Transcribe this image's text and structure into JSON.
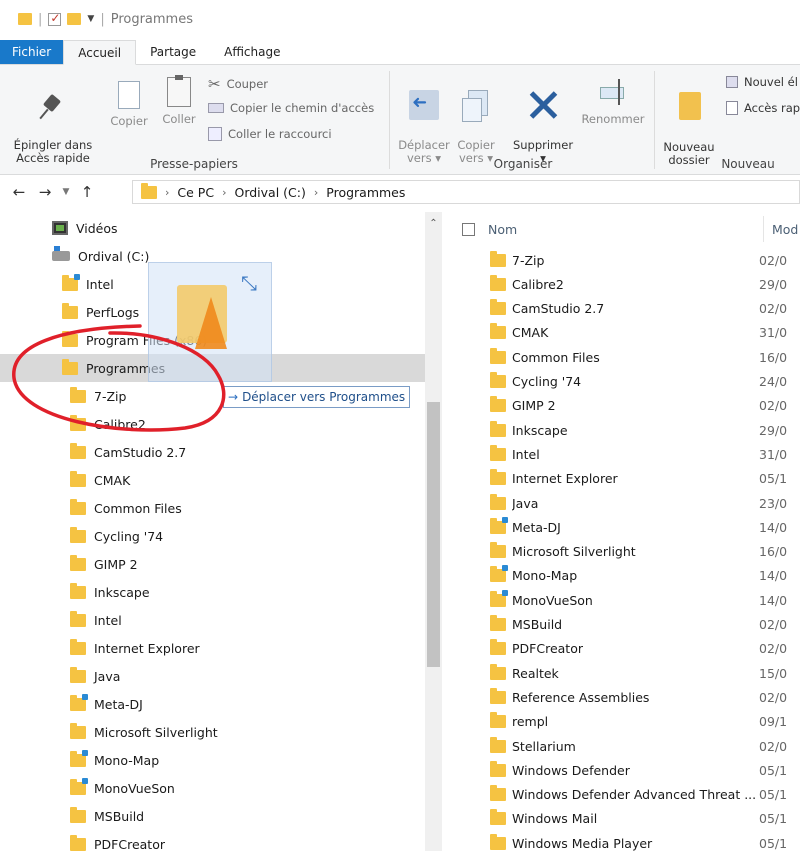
{
  "titlebar": {
    "title": "Programmes"
  },
  "ribbon_tabs": [
    "Fichier",
    "Accueil",
    "Partage",
    "Affichage"
  ],
  "ribbon": {
    "epingler": "Épingler dans\nAccès rapide",
    "copier": "Copier",
    "coller": "Coller",
    "couper": "Couper",
    "copier_chemin": "Copier le chemin d'accès",
    "coller_raccourci": "Coller le raccourci",
    "group_presse": "Presse-papiers",
    "deplacer_vers": "Déplacer\nvers ▾",
    "copier_vers": "Copier\nvers ▾",
    "supprimer": "Supprimer\n▾",
    "renommer": "Renommer",
    "group_organiser": "Organiser",
    "nouveau_dossier": "Nouveau\ndossier",
    "nouvel_element": "Nouvel él",
    "acces_rapide": "Accès rap",
    "group_nouveau": "Nouveau"
  },
  "address": {
    "crumbs": [
      "Ce PC",
      "Ordival (C:)",
      "Programmes"
    ]
  },
  "tree": {
    "items": [
      {
        "label": "Vidéos",
        "icon": "video",
        "indent": 52
      },
      {
        "label": "Ordival (C:)",
        "icon": "drive",
        "indent": 52
      },
      {
        "label": "Intel",
        "icon": "folder-special",
        "indent": 62
      },
      {
        "label": "PerfLogs",
        "icon": "folder",
        "indent": 62
      },
      {
        "label": "Program Files (x86)",
        "icon": "folder",
        "indent": 62
      },
      {
        "label": "Programmes",
        "icon": "folder",
        "indent": 62
      },
      {
        "label": "7-Zip",
        "icon": "folder",
        "indent": 70
      },
      {
        "label": "Calibre2",
        "icon": "folder",
        "indent": 70
      },
      {
        "label": "CamStudio 2.7",
        "icon": "folder",
        "indent": 70
      },
      {
        "label": "CMAK",
        "icon": "folder",
        "indent": 70
      },
      {
        "label": "Common Files",
        "icon": "folder",
        "indent": 70
      },
      {
        "label": "Cycling '74",
        "icon": "folder",
        "indent": 70
      },
      {
        "label": "GIMP 2",
        "icon": "folder",
        "indent": 70
      },
      {
        "label": "Inkscape",
        "icon": "folder",
        "indent": 70
      },
      {
        "label": "Intel",
        "icon": "folder",
        "indent": 70
      },
      {
        "label": "Internet Explorer",
        "icon": "folder",
        "indent": 70
      },
      {
        "label": "Java",
        "icon": "folder",
        "indent": 70
      },
      {
        "label": "Meta-DJ",
        "icon": "folder-special",
        "indent": 70
      },
      {
        "label": "Microsoft Silverlight",
        "icon": "folder",
        "indent": 70
      },
      {
        "label": "Mono-Map",
        "icon": "folder-special",
        "indent": 70
      },
      {
        "label": "MonoVueSon",
        "icon": "folder-special",
        "indent": 70
      },
      {
        "label": "MSBuild",
        "icon": "folder",
        "indent": 70
      },
      {
        "label": "PDFCreator",
        "icon": "folder",
        "indent": 70
      }
    ],
    "selected_index": 5
  },
  "list": {
    "header_name": "Nom",
    "header_modified": "Mod",
    "rows": [
      {
        "name": "7-Zip",
        "date": "02/0",
        "icon": "folder"
      },
      {
        "name": "Calibre2",
        "date": "29/0",
        "icon": "folder"
      },
      {
        "name": "CamStudio 2.7",
        "date": "02/0",
        "icon": "folder"
      },
      {
        "name": "CMAK",
        "date": "31/0",
        "icon": "folder"
      },
      {
        "name": "Common Files",
        "date": "16/0",
        "icon": "folder"
      },
      {
        "name": "Cycling '74",
        "date": "24/0",
        "icon": "folder"
      },
      {
        "name": "GIMP 2",
        "date": "02/0",
        "icon": "folder"
      },
      {
        "name": "Inkscape",
        "date": "29/0",
        "icon": "folder"
      },
      {
        "name": "Intel",
        "date": "31/0",
        "icon": "folder"
      },
      {
        "name": "Internet Explorer",
        "date": "05/1",
        "icon": "folder"
      },
      {
        "name": "Java",
        "date": "23/0",
        "icon": "folder"
      },
      {
        "name": "Meta-DJ",
        "date": "14/0",
        "icon": "folder-special"
      },
      {
        "name": "Microsoft Silverlight",
        "date": "16/0",
        "icon": "folder"
      },
      {
        "name": "Mono-Map",
        "date": "14/0",
        "icon": "folder-special"
      },
      {
        "name": "MonoVueSon",
        "date": "14/0",
        "icon": "folder-special"
      },
      {
        "name": "MSBuild",
        "date": "02/0",
        "icon": "folder"
      },
      {
        "name": "PDFCreator",
        "date": "02/0",
        "icon": "folder"
      },
      {
        "name": "Realtek",
        "date": "15/0",
        "icon": "folder"
      },
      {
        "name": "Reference Assemblies",
        "date": "02/0",
        "icon": "folder"
      },
      {
        "name": "rempl",
        "date": "09/1",
        "icon": "folder"
      },
      {
        "name": "Stellarium",
        "date": "02/0",
        "icon": "folder"
      },
      {
        "name": "Windows Defender",
        "date": "05/1",
        "icon": "folder"
      },
      {
        "name": "Windows Defender Advanced Threat ...",
        "date": "05/1",
        "icon": "folder"
      },
      {
        "name": "Windows Mail",
        "date": "05/1",
        "icon": "folder"
      },
      {
        "name": "Windows Media Player",
        "date": "05/1",
        "icon": "folder"
      }
    ]
  },
  "drag": {
    "tooltip": "Déplacer vers Programmes",
    "arrow": "→"
  },
  "colors": {
    "accent": "#1979ca",
    "annotation": "#e0202a",
    "folder": "#f5c342",
    "selection": "#d9d9d9"
  }
}
